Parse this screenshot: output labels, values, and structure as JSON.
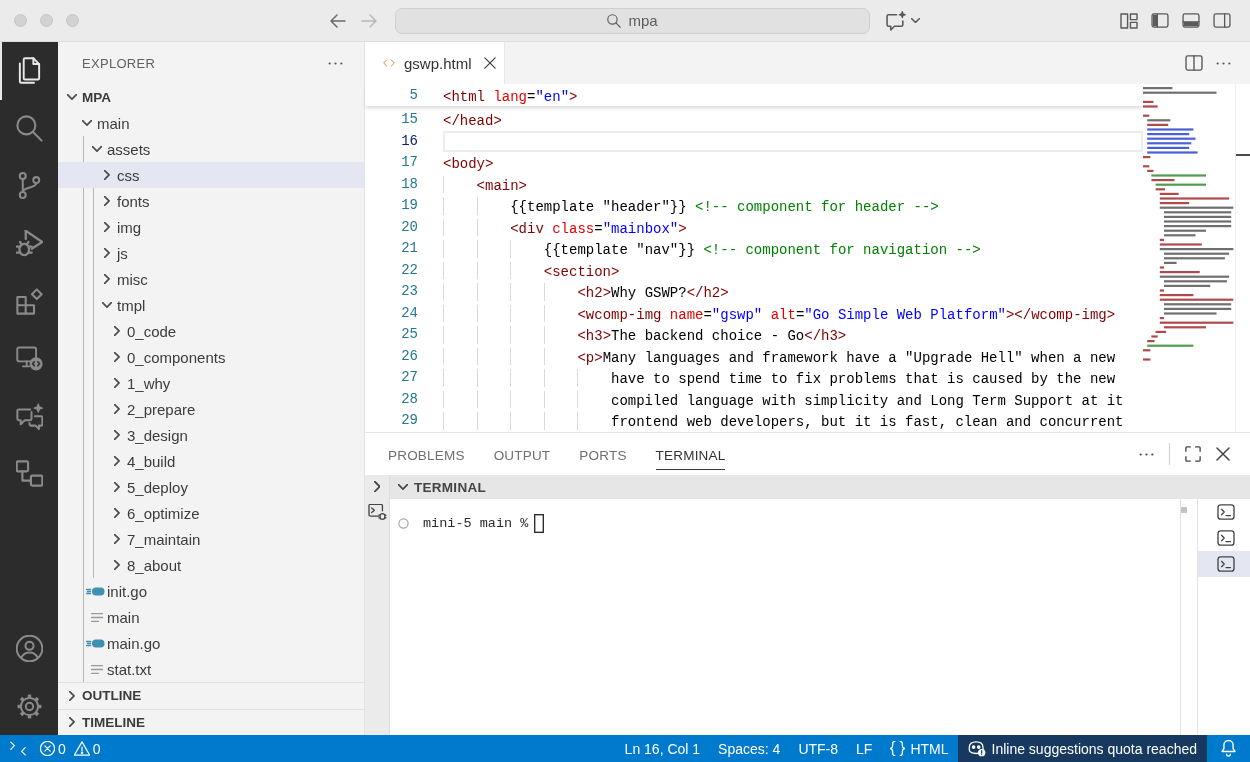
{
  "title_bar": {
    "navigation": [
      {
        "kind": "back",
        "disabled": false
      },
      {
        "kind": "forward",
        "disabled": true
      }
    ],
    "search": "mpa",
    "layout_toggles": [
      {
        "kind": "sidebar",
        "on": true
      },
      {
        "kind": "panel",
        "on": true
      },
      {
        "kind": "auxiliary",
        "on": false
      }
    ]
  },
  "activity_bar": {
    "items": [
      {
        "kind": "explorer",
        "selected": true
      },
      {
        "kind": "search",
        "selected": false
      },
      {
        "kind": "scm",
        "selected": false
      },
      {
        "kind": "debug",
        "selected": false
      },
      {
        "kind": "extensions",
        "selected": false
      },
      {
        "kind": "remote",
        "selected": false
      },
      {
        "kind": "chat",
        "selected": false
      },
      {
        "kind": "nodes",
        "selected": false
      }
    ]
  },
  "explorer": {
    "title": "EXPLORER",
    "workspace": {
      "label": "MPA",
      "expanded": true,
      "selected": false,
      "children": [
        {
          "kind": "folder",
          "label": "main",
          "expanded": true,
          "selected": false,
          "children": [
            {
              "kind": "folder",
              "label": "assets",
              "expanded": true,
              "selected": false,
              "children": [
                {
                  "kind": "folder",
                  "label": "css",
                  "expanded": false,
                  "selected": true
                },
                {
                  "kind": "folder",
                  "label": "fonts",
                  "expanded": false,
                  "selected": false
                },
                {
                  "kind": "folder",
                  "label": "img",
                  "expanded": false,
                  "selected": false
                },
                {
                  "kind": "folder",
                  "label": "js",
                  "expanded": false,
                  "selected": false
                },
                {
                  "kind": "folder",
                  "label": "misc",
                  "expanded": false,
                  "selected": false
                },
                {
                  "kind": "folder",
                  "label": "tmpl",
                  "expanded": true,
                  "selected": false,
                  "children": [
                    {
                      "kind": "folder",
                      "label": "0_code",
                      "expanded": false,
                      "selected": false
                    },
                    {
                      "kind": "folder",
                      "label": "0_components",
                      "expanded": false,
                      "selected": false
                    },
                    {
                      "kind": "folder",
                      "label": "1_why",
                      "expanded": false,
                      "selected": false
                    },
                    {
                      "kind": "folder",
                      "label": "2_prepare",
                      "expanded": false,
                      "selected": false
                    },
                    {
                      "kind": "folder",
                      "label": "3_design",
                      "expanded": false,
                      "selected": false
                    },
                    {
                      "kind": "folder",
                      "label": "4_build",
                      "expanded": false,
                      "selected": false
                    },
                    {
                      "kind": "folder",
                      "label": "5_deploy",
                      "expanded": false,
                      "selected": false
                    },
                    {
                      "kind": "folder",
                      "label": "6_optimize",
                      "expanded": false,
                      "selected": false
                    },
                    {
                      "kind": "folder",
                      "label": "7_maintain",
                      "expanded": false,
                      "selected": false
                    },
                    {
                      "kind": "folder",
                      "label": "8_about",
                      "expanded": false,
                      "selected": false
                    }
                  ]
                }
              ]
            },
            {
              "kind": "go",
              "label": "init.go",
              "selected": false
            },
            {
              "kind": "file",
              "label": "main",
              "selected": false
            },
            {
              "kind": "go",
              "label": "main.go",
              "selected": false
            },
            {
              "kind": "file",
              "label": "stat.txt",
              "selected": false
            }
          ]
        }
      ]
    },
    "sections": [
      {
        "label": "OUTLINE",
        "expanded": false
      },
      {
        "label": "TIMELINE",
        "expanded": false
      }
    ]
  },
  "editor": {
    "tabs": [
      {
        "label": "gswp.html",
        "selected": true
      }
    ],
    "sticky_lines": [
      {
        "number": "5",
        "tokens": [
          {
            "kind": "tag",
            "text": "<html"
          },
          {
            "kind": "attr",
            "text": " lang"
          },
          {
            "kind": "text",
            "text": "="
          },
          {
            "kind": "str",
            "text": "\"en\""
          },
          {
            "kind": "tag",
            "text": ">"
          }
        ]
      }
    ],
    "lines": [
      {
        "number": "15",
        "current": false,
        "tokens": [
          {
            "kind": "tag",
            "text": "</head>"
          }
        ]
      },
      {
        "number": "16",
        "current": true
      },
      {
        "number": "17",
        "current": false,
        "tokens": [
          {
            "kind": "tag",
            "text": "<body>"
          }
        ]
      },
      {
        "number": "18",
        "current": false,
        "tokens": [
          {
            "kind": "tag",
            "text": "    <main>"
          }
        ]
      },
      {
        "number": "19",
        "current": false,
        "tokens": [
          {
            "kind": "text",
            "text": "        {{template \"header\"}} "
          },
          {
            "kind": "comment",
            "text": "<!-- component for header -->"
          }
        ]
      },
      {
        "number": "20",
        "current": false,
        "tokens": [
          {
            "kind": "tag",
            "text": "        <div"
          },
          {
            "kind": "attr",
            "text": " class"
          },
          {
            "kind": "text",
            "text": "="
          },
          {
            "kind": "str",
            "text": "\"mainbox\""
          },
          {
            "kind": "tag",
            "text": ">"
          }
        ]
      },
      {
        "number": "21",
        "current": false,
        "tokens": [
          {
            "kind": "text",
            "text": "            {{template \"nav\"}} "
          },
          {
            "kind": "comment",
            "text": "<!-- component for navigation -->"
          }
        ]
      },
      {
        "number": "22",
        "current": false,
        "tokens": [
          {
            "kind": "tag",
            "text": "            <section>"
          }
        ]
      },
      {
        "number": "23",
        "current": false,
        "tokens": [
          {
            "kind": "tag",
            "text": "                <h2>"
          },
          {
            "kind": "text",
            "text": "Why GSWP?"
          },
          {
            "kind": "tag",
            "text": "</h2>"
          }
        ]
      },
      {
        "number": "24",
        "current": false,
        "tokens": [
          {
            "kind": "tag",
            "text": "                <wcomp-img"
          },
          {
            "kind": "attr",
            "text": " name"
          },
          {
            "kind": "text",
            "text": "="
          },
          {
            "kind": "str",
            "text": "\"gswp\""
          },
          {
            "kind": "attr",
            "text": " alt"
          },
          {
            "kind": "text",
            "text": "="
          },
          {
            "kind": "str",
            "text": "\"Go Simple Web Platform\""
          },
          {
            "kind": "tag",
            "text": "></wcomp-img>"
          }
        ]
      },
      {
        "number": "25",
        "current": false,
        "tokens": [
          {
            "kind": "tag",
            "text": "                <h3>"
          },
          {
            "kind": "text",
            "text": "The backend choice - Go"
          },
          {
            "kind": "tag",
            "text": "</h3>"
          }
        ]
      },
      {
        "number": "26",
        "current": false,
        "tokens": [
          {
            "kind": "tag",
            "text": "                <p>"
          },
          {
            "kind": "text",
            "text": "Many languages and framework have a \"Upgrade Hell\" when a new"
          }
        ]
      },
      {
        "number": "27",
        "current": false,
        "tokens": [
          {
            "kind": "text",
            "text": "                    have to spend time to fix problems that is caused by the new"
          }
        ]
      },
      {
        "number": "28",
        "current": false,
        "tokens": [
          {
            "kind": "text",
            "text": "                    compiled language with simplicity and Long Term Support at it"
          }
        ]
      },
      {
        "number": "29",
        "current": false,
        "tokens": [
          {
            "kind": "text",
            "text": "                    frontend web developers, but it is fast, clean and concurrent"
          }
        ]
      }
    ]
  },
  "panel": {
    "tabs": [
      {
        "label": "PROBLEMS",
        "selected": false
      },
      {
        "label": "OUTPUT",
        "selected": false
      },
      {
        "label": "PORTS",
        "selected": false
      },
      {
        "label": "TERMINAL",
        "selected": true
      }
    ],
    "terminal": {
      "title": "TERMINAL",
      "expanded": true,
      "prompt": "mini-5 main %",
      "sessions": [
        {
          "selected": false
        },
        {
          "selected": false
        },
        {
          "selected": true
        }
      ]
    }
  },
  "status_bar": {
    "problems": {
      "errors": "0",
      "warnings": "0"
    },
    "items": [
      {
        "kind": "text",
        "text": "Ln 16, Col 1"
      },
      {
        "kind": "text",
        "text": "Spaces: 4"
      },
      {
        "kind": "text",
        "text": "UTF-8"
      },
      {
        "kind": "text",
        "text": "LF"
      },
      {
        "kind": "language",
        "text": "HTML"
      },
      {
        "kind": "quota",
        "text": "Inline suggestions quota reached"
      },
      {
        "kind": "bell"
      }
    ]
  }
}
